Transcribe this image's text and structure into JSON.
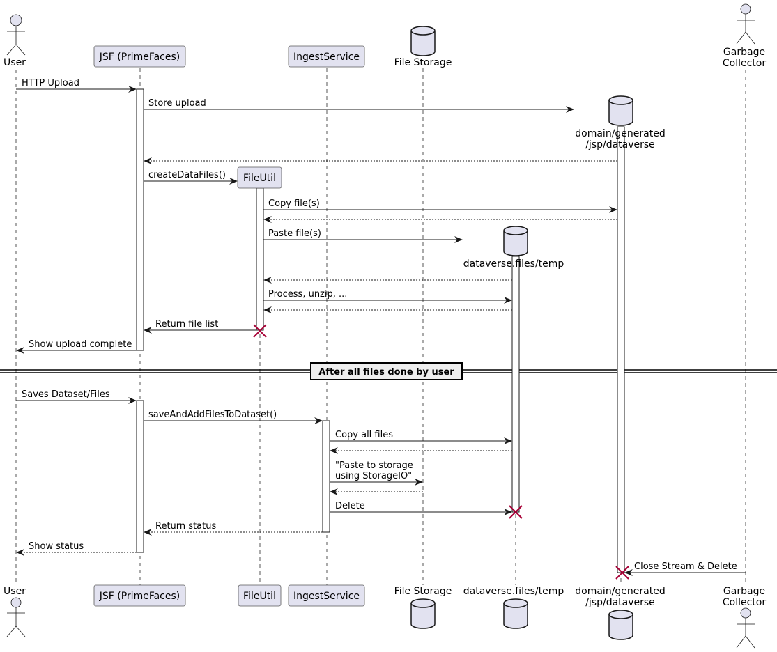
{
  "diagram": {
    "type": "sequence",
    "colors": {
      "participant_fill": "#E2E2F0",
      "participant_stroke": "#181818",
      "box_stroke": "#5A5A5A",
      "lifeline": "#555555",
      "arrow": "#181818",
      "destroy": "#A80036",
      "divider_fill": "#EEEEEE"
    },
    "participants": [
      {
        "id": "user",
        "label": "User",
        "kind": "actor"
      },
      {
        "id": "jsf",
        "label": "JSF (PrimeFaces)",
        "kind": "participant"
      },
      {
        "id": "fileutil",
        "label": "FileUtil",
        "kind": "participant"
      },
      {
        "id": "ingest",
        "label": "IngestService",
        "kind": "participant"
      },
      {
        "id": "filestorage",
        "label": "File Storage",
        "kind": "database"
      },
      {
        "id": "temp",
        "label": "dataverse.files/temp",
        "kind": "database"
      },
      {
        "id": "domain",
        "label_line1": "domain/generated",
        "label_line2": "/jsp/dataverse",
        "kind": "database"
      },
      {
        "id": "gc",
        "label_line1": "Garbage",
        "label_line2": "Collector",
        "kind": "actor"
      }
    ],
    "messages": [
      {
        "from": "user",
        "to": "jsf",
        "label": "HTTP Upload",
        "style": "solid"
      },
      {
        "from": "jsf",
        "to": "domain",
        "label": "Store upload",
        "style": "solid",
        "creates": true
      },
      {
        "from": "domain",
        "to": "jsf",
        "label": "",
        "style": "dashed"
      },
      {
        "from": "jsf",
        "to": "fileutil",
        "label": "createDataFiles()",
        "style": "solid",
        "creates": true
      },
      {
        "from": "fileutil",
        "to": "domain",
        "label": "Copy file(s)",
        "style": "solid"
      },
      {
        "from": "domain",
        "to": "fileutil",
        "label": "",
        "style": "dashed"
      },
      {
        "from": "fileutil",
        "to": "temp",
        "label": "Paste file(s)",
        "style": "solid",
        "creates": true
      },
      {
        "from": "temp",
        "to": "fileutil",
        "label": "",
        "style": "dashed"
      },
      {
        "from": "fileutil",
        "to": "temp",
        "label": "Process, unzip, ...",
        "style": "solid"
      },
      {
        "from": "temp",
        "to": "fileutil",
        "label": "",
        "style": "dashed"
      },
      {
        "from": "fileutil",
        "to": "jsf",
        "label": "Return file list",
        "style": "solid",
        "destroys_source": true
      },
      {
        "from": "jsf",
        "to": "user",
        "label": "Show upload complete",
        "style": "solid"
      },
      {
        "from": "user",
        "to": "jsf",
        "label": "Saves Dataset/Files",
        "style": "solid"
      },
      {
        "from": "jsf",
        "to": "ingest",
        "label": "saveAndAddFilesToDataset()",
        "style": "solid"
      },
      {
        "from": "ingest",
        "to": "temp",
        "label": "Copy all files",
        "style": "solid"
      },
      {
        "from": "temp",
        "to": "ingest",
        "label": "",
        "style": "dashed"
      },
      {
        "from": "ingest",
        "to": "filestorage",
        "label_line1": "\"Paste to storage",
        "label_line2": "using StorageIO\"",
        "style": "solid"
      },
      {
        "from": "filestorage",
        "to": "ingest",
        "label": "",
        "style": "dashed"
      },
      {
        "from": "ingest",
        "to": "temp",
        "label": "Delete",
        "style": "solid",
        "destroys_target": true
      },
      {
        "from": "ingest",
        "to": "jsf",
        "label": "Return status",
        "style": "dashed"
      },
      {
        "from": "jsf",
        "to": "user",
        "label": "Show status",
        "style": "dashed"
      },
      {
        "from": "gc",
        "to": "domain",
        "label": "Close Stream & Delete",
        "style": "solid",
        "destroys_target": true
      }
    ],
    "divider": {
      "label": "After all files done by user"
    }
  }
}
